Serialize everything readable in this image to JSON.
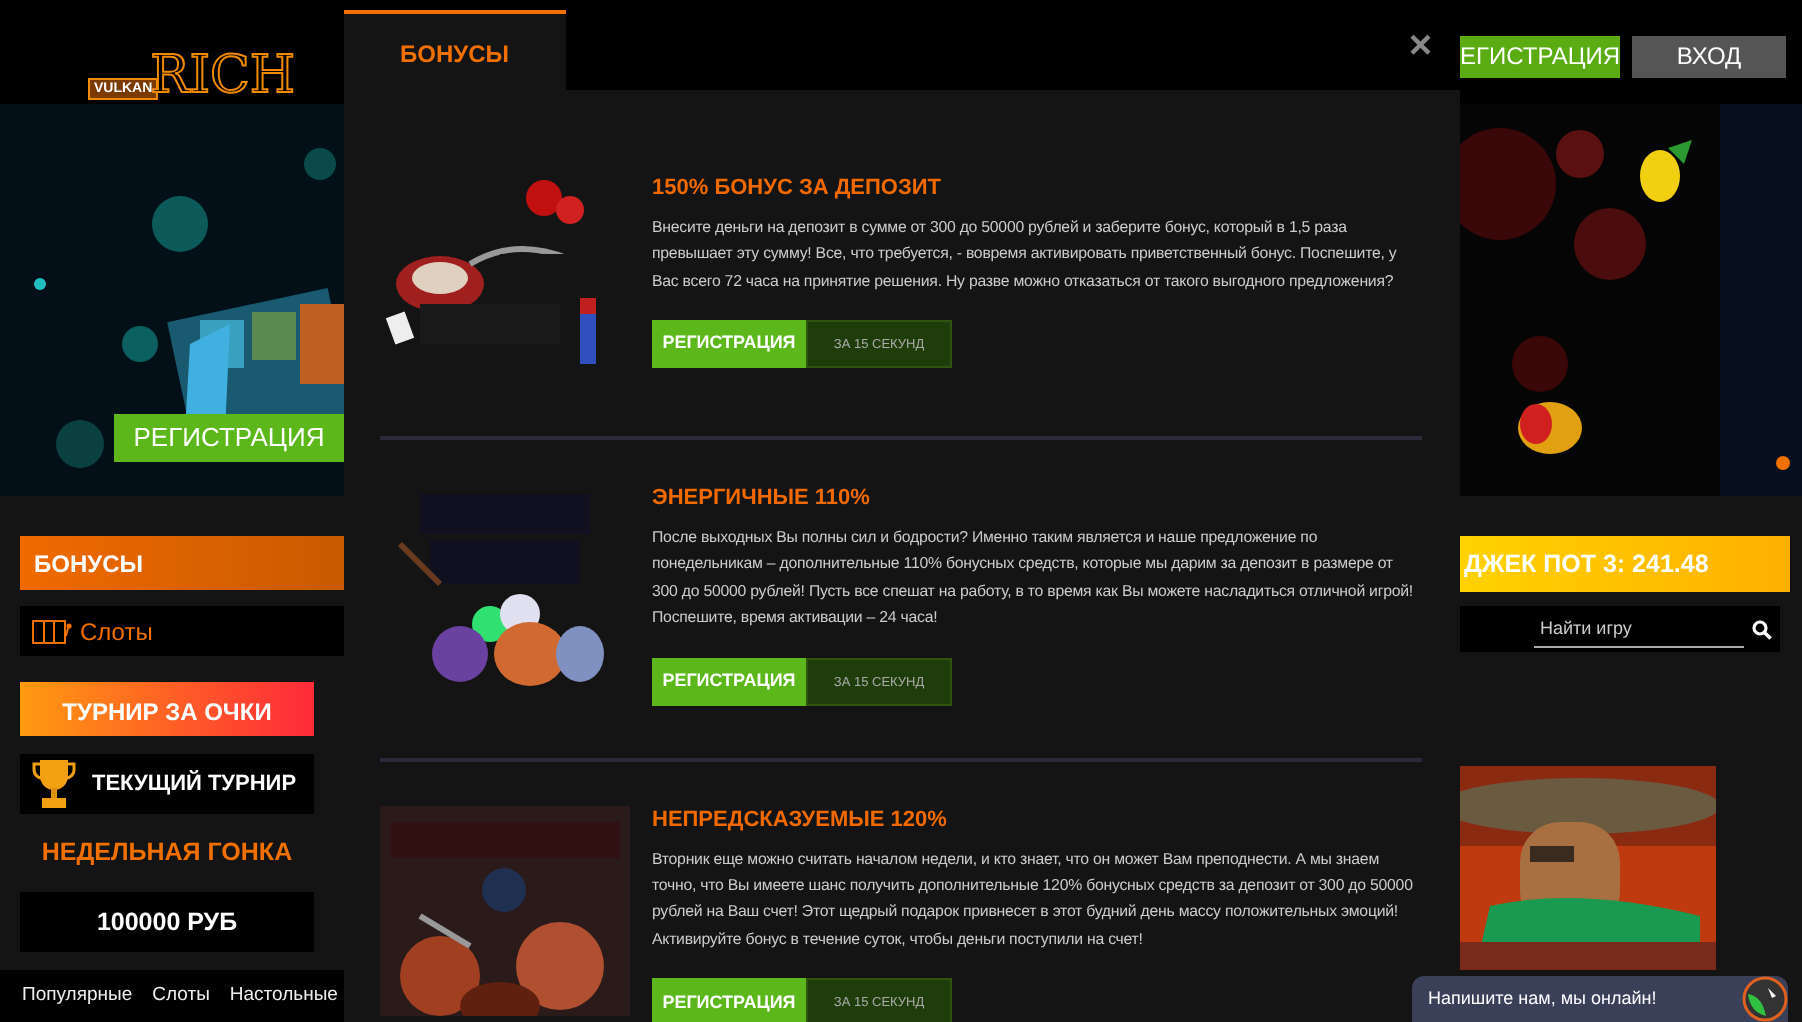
{
  "header": {
    "logo": {
      "word": "RICH",
      "sub": "VULKAN"
    },
    "buttons": [
      {
        "label": "ЕГИСТРАЦИЯ",
        "kind": "register"
      },
      {
        "label": "ВХОД",
        "kind": "login"
      }
    ]
  },
  "hero": {
    "register_button": "РЕГИСТРАЦИЯ",
    "dots": [
      {
        "selected": true
      }
    ]
  },
  "sidebar": {
    "items": [
      {
        "kind": "bonus",
        "label": "БОНУСЫ"
      },
      {
        "kind": "category",
        "label": "Слоты"
      },
      {
        "kind": "tournament",
        "label": "ТУРНИР ЗА ОЧКИ"
      },
      {
        "kind": "current",
        "label": "ТЕКУЩИЙ ТУРНИР"
      },
      {
        "kind": "heading",
        "label": "НЕДЕЛЬНАЯ ГОНКА"
      },
      {
        "kind": "prize",
        "label": "100000 РУБ"
      }
    ]
  },
  "bottom_tabs": [
    "Популярные",
    "Слоты",
    "Настольные"
  ],
  "jackpot": "ДЖЕК ПОТ 3: 241.48",
  "search": {
    "placeholder": "Найти игру"
  },
  "chat": {
    "label": "Напишите нам, мы онлайн!"
  },
  "modal": {
    "tabs": [
      {
        "label": "БОНУСЫ",
        "selected": true
      }
    ],
    "close": "×",
    "bonuses": [
      {
        "title": "150% БОНУС ЗА ДЕПОЗИТ",
        "text": "Внесите деньги на депозит в сумме от 300 до 50000 рублей и заберите бонус, который в 1,5 раза превышает эту сумму! Все, что требуется, - вовремя активировать приветственный бонус. Поспешите, у Вас всего 72 часа на принятие решения. Ну разве можно отказаться от такого выгодного предложения?",
        "button": "РЕГИСТРАЦИЯ",
        "note": "ЗА 15 СЕКУНД"
      },
      {
        "title": "ЭНЕРГИЧНЫЕ 110%",
        "text": "После выходных Вы полны сил и бодрости? Именно таким является и наше предложение по понедельникам – дополнительные 110% бонусных средств, которые мы дарим за депозит в размере от 300 до 50000 рублей! Пусть все спешат на работу, в то время как Вы можете насладиться отличной игрой! Поспешите, время активации – 24 часа!",
        "button": "РЕГИСТРАЦИЯ",
        "note": "ЗА 15 СЕКУНД"
      },
      {
        "title": "НЕПРЕДСКАЗУЕМЫЕ 120%",
        "text": "Вторник еще можно считать началом недели, и кто знает, что он может Вам преподнести. А мы знаем точно, что Вы имеете шанс получить дополнительные 120% бонусных средств за депозит от 300 до 50000 рублей на Ваш счет! Этот щедрый подарок привнесет в этот будний день массу положительных эмоций! Активируйте бонус в течение суток, чтобы деньги поступили на счет!",
        "button": "РЕГИСТРАЦИЯ",
        "note": "ЗА 15 СЕКУНД"
      }
    ]
  }
}
